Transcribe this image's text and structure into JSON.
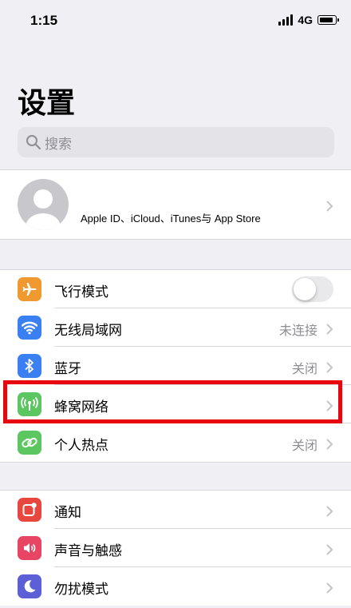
{
  "status_bar": {
    "time": "1:15",
    "network": "4G"
  },
  "page_title": "设置",
  "search": {
    "placeholder": "搜索"
  },
  "profile": {
    "subtitle": "Apple ID、iCloud、iTunes与 App Store"
  },
  "group1": [
    {
      "label": "飞行模式",
      "icon": "airplane-icon",
      "color": "#f0992e",
      "toggle_on": false
    },
    {
      "label": "无线局域网",
      "icon": "wifi-icon",
      "color": "#3b80f3",
      "value": "未连接"
    },
    {
      "label": "蓝牙",
      "icon": "bluetooth-icon",
      "color": "#3b80f3",
      "value": "关闭"
    },
    {
      "label": "蜂窝网络",
      "icon": "cellular-icon",
      "color": "#5cc660",
      "highlighted": true
    },
    {
      "label": "个人热点",
      "icon": "hotspot-icon",
      "color": "#5cc660",
      "value": "关闭"
    }
  ],
  "group2": [
    {
      "label": "通知",
      "icon": "notifications-icon",
      "color": "#e8473f"
    },
    {
      "label": "声音与触感",
      "icon": "sound-icon",
      "color": "#e84565"
    },
    {
      "label": "勿扰模式",
      "icon": "moon-icon",
      "color": "#5d5fd6"
    }
  ],
  "colors": {
    "highlight": "#e8070f",
    "background": "#efeff4"
  }
}
